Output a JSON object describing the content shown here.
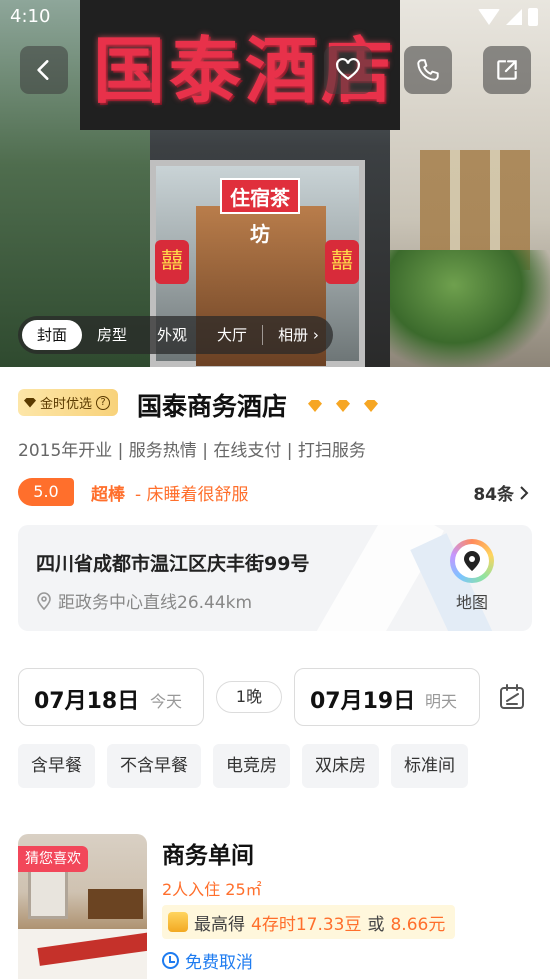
{
  "status": {
    "time": "4:10"
  },
  "hero": {
    "sign_text": "国泰酒店",
    "door_sign": "住宿茶坊",
    "lantern_char": "囍",
    "tabs": [
      "封面",
      "房型",
      "外观",
      "大厅"
    ],
    "album_label": "相册",
    "active_tab": "封面"
  },
  "hotel": {
    "badge": "金时优选",
    "name": "国泰商务酒店",
    "star_count": 3,
    "tags": "2015年开业 | 服务热情 | 在线支付 | 打扫服务",
    "score": "5.0",
    "score_word": "超棒",
    "score_desc": "- 床睡着很舒服",
    "review_count": "84条"
  },
  "address": {
    "main": "四川省成都市温江区庆丰街99号",
    "distance": "距政务中心直线26.44km",
    "map_label": "地图"
  },
  "dates": {
    "checkin": "07月18日",
    "checkin_day": "今天",
    "nights": "1晚",
    "checkout": "07月19日",
    "checkout_day": "明天"
  },
  "filters": [
    "含早餐",
    "不含早餐",
    "电竞房",
    "双床房",
    "标准间"
  ],
  "room": {
    "tag": "猜您喜欢",
    "name": "商务单间",
    "occupancy": "2人入住 25㎡",
    "reward_prefix": "最高得",
    "reward_value": "4存时17.33豆",
    "reward_or": "或",
    "reward_cash": "8.66元",
    "free_cancel": "免费取消"
  },
  "colors": {
    "accent_orange": "#ff6f2c",
    "link_blue": "#1f7cf0",
    "tag_red": "#f2475a",
    "gold_badge": "#f8d27a"
  }
}
